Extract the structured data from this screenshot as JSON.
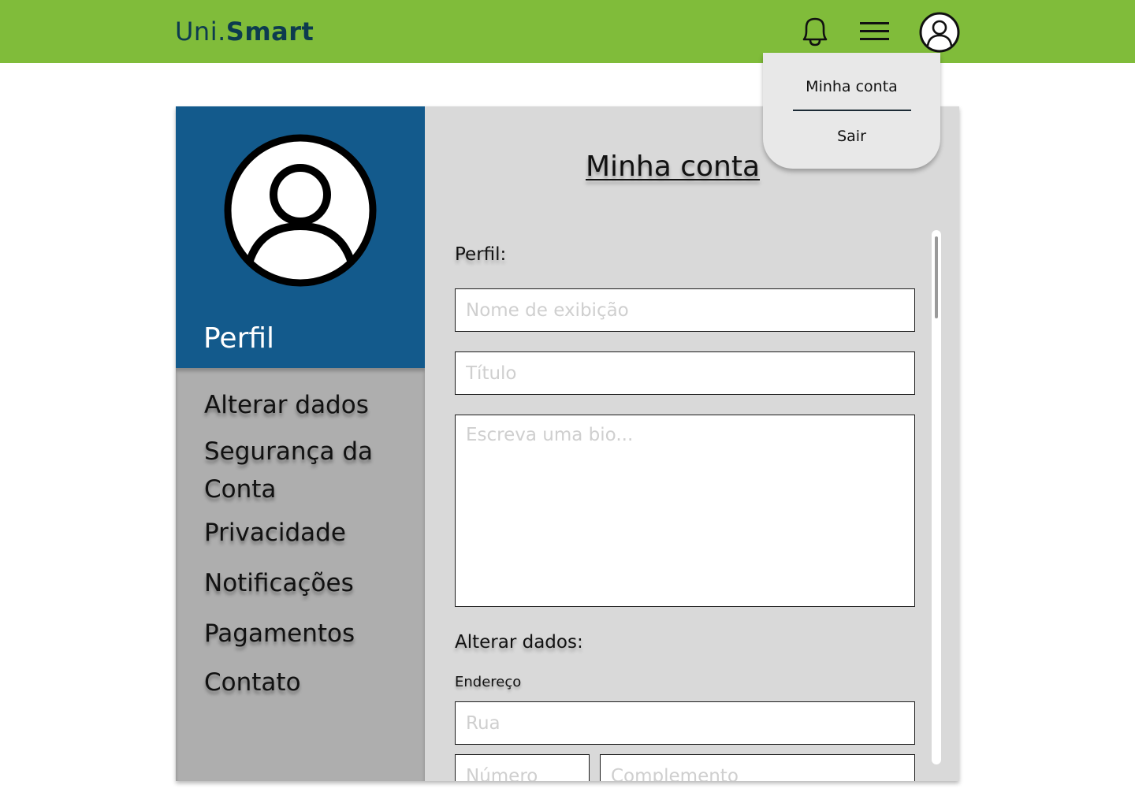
{
  "app": {
    "logo_part1": "Uni.",
    "logo_part2": "Smart"
  },
  "header": {
    "icons": [
      "bell-icon",
      "menu-icon",
      "user-icon"
    ]
  },
  "dropdown": {
    "items": [
      "Minha conta",
      "Sair"
    ]
  },
  "sidebar": {
    "title": "Perfil",
    "items": [
      "Alterar dados",
      "Segurança da Conta",
      "Privacidade",
      "Notificações",
      "Pagamentos",
      "Contato"
    ]
  },
  "main": {
    "title": "Minha conta",
    "profile_label": "Perfil:",
    "display_name": {
      "value": "",
      "placeholder": "Nome de exibição"
    },
    "title_field": {
      "value": "",
      "placeholder": "Título"
    },
    "bio": {
      "value": "",
      "placeholder": "Escreva uma bio..."
    },
    "alterar_label": "Alterar dados:",
    "address_label": "Endereço",
    "street": {
      "value": "",
      "placeholder": "Rua"
    },
    "number": {
      "value": "",
      "placeholder": "Número"
    },
    "complement": {
      "value": "",
      "placeholder": "Complemento"
    }
  },
  "colors": {
    "header": "#80bc3a",
    "logo": "#0d3b4f",
    "sidebar_top": "#135a8c",
    "sidebar_bottom": "#aeaeae",
    "card": "#d9d9d9",
    "dropdown": "#e8e8e8"
  }
}
